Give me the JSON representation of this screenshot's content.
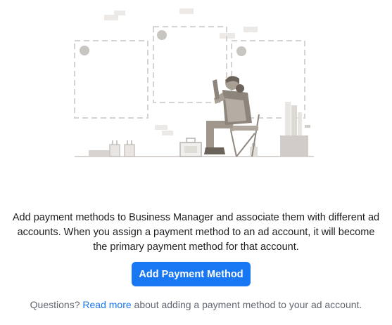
{
  "description": "Add payment methods to Business Manager and associate them with different ad accounts. When you assign a payment method to an ad account, it will become the primary payment method for that account.",
  "primary_button": {
    "label": "Add Payment Method"
  },
  "footer": {
    "prefix": "Questions?",
    "link_label": "Read more",
    "suffix": "about adding a payment method to your ad account."
  },
  "colors": {
    "accent": "#1877f2",
    "illustration_gray": "#d0ccc8",
    "figure_brown": "#a89f95",
    "figure_dark": "#6b625a"
  },
  "illustration": {
    "icon": "person-with-empty-frames-illustration"
  }
}
